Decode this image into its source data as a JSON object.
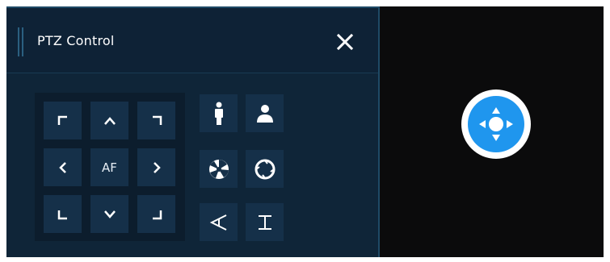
{
  "panel": {
    "title": "PTZ Control",
    "close_icon": "close-icon"
  },
  "direction_pad": {
    "up_left": "arrow-up-left-icon",
    "up": "chevron-up-icon",
    "up_right": "arrow-up-right-icon",
    "left": "chevron-left-icon",
    "center_label": "AF",
    "right": "chevron-right-icon",
    "down_left": "arrow-down-left-icon",
    "down": "chevron-down-icon",
    "down_right": "arrow-down-right-icon"
  },
  "camera_controls": [
    {
      "icon": "zoom-in-person-icon"
    },
    {
      "icon": "zoom-out-person-icon"
    },
    {
      "icon": "iris-close-icon"
    },
    {
      "icon": "iris-open-icon"
    },
    {
      "icon": "focus-near-icon"
    },
    {
      "icon": "focus-far-icon"
    }
  ],
  "joystick": {
    "icon": "joystick-move-icon"
  },
  "colors": {
    "panel_bg": "#0f2538",
    "header_bg": "#0e2236",
    "button_bg": "#153049",
    "accent": "#1f96ee",
    "text": "#ffffff"
  }
}
